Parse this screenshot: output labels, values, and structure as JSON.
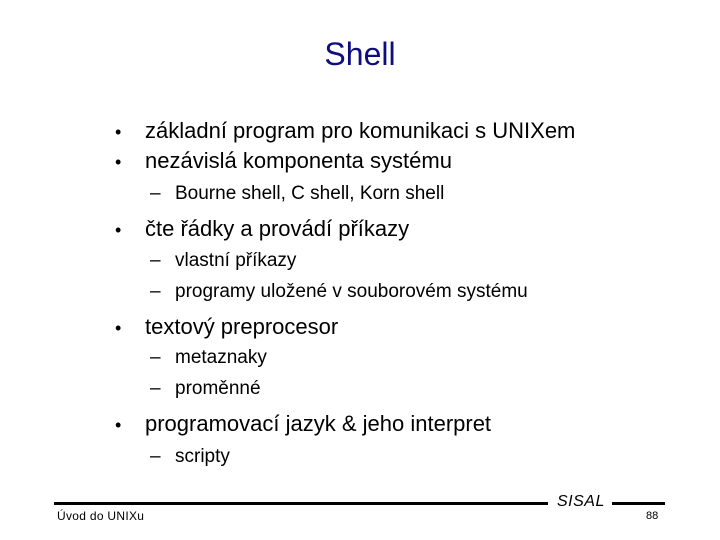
{
  "slide": {
    "title": "Shell",
    "bullet_glyph": "•",
    "dash_glyph": "–",
    "items": [
      {
        "level": 1,
        "text": "základní program pro komunikaci s UNIXem"
      },
      {
        "level": 1,
        "text": "nezávislá komponenta systému"
      },
      {
        "level": 2,
        "text": "Bourne shell, C shell, Korn shell"
      },
      {
        "level": 1,
        "text": "čte řádky a provádí příkazy"
      },
      {
        "level": 2,
        "text": "vlastní příkazy"
      },
      {
        "level": 2,
        "text": "programy uložené v souborovém systému"
      },
      {
        "level": 1,
        "text": "textový preprocesor"
      },
      {
        "level": 2,
        "text": "metaznaky"
      },
      {
        "level": 2,
        "text": "proměnné"
      },
      {
        "level": 1,
        "text": "programovací jazyk & jeho interpret"
      },
      {
        "level": 2,
        "text": "scripty"
      }
    ]
  },
  "footer": {
    "course": "Úvod do UNIXu",
    "brand": "SISAL",
    "page_number": "88"
  },
  "colors": {
    "title": "#0d0d80",
    "text": "#000000",
    "background": "#ffffff"
  }
}
